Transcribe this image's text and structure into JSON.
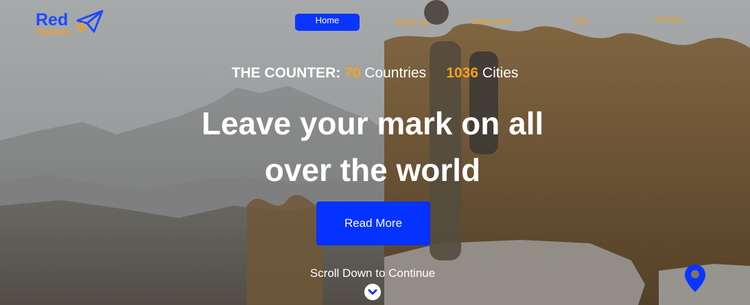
{
  "brand": {
    "name": "Red",
    "subtitle": "Explorers"
  },
  "nav": {
    "home": "Home",
    "about": "About us",
    "destination": "Destination",
    "tips": "Tips",
    "contact": "Contact"
  },
  "counter": {
    "prefix": "THE COUNTER:",
    "countries_count": "70",
    "countries_label": "Countries",
    "cities_count": "1036",
    "cities_label": "Cities"
  },
  "hero": {
    "headline": "Leave your mark on all over the world",
    "cta_label": "Read More",
    "scroll_label": "Scroll Down to Continue"
  },
  "icons": {
    "logo": "paper-plane-icon",
    "scroll": "chevron-down-icon",
    "location": "map-pin-icon"
  },
  "colors": {
    "accent": "#0a35ff",
    "highlight": "#f2a11b"
  }
}
